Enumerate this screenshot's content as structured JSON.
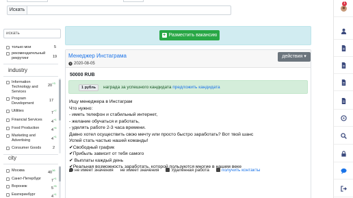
{
  "search": {
    "button_label": "Искать",
    "placeholder": ""
  },
  "sidebar": {
    "filter_placeholder": "искать",
    "top_items": [
      {
        "label": "только мои",
        "count": "5"
      },
      {
        "label": "рекомендательный рекрутинг",
        "count": "19"
      }
    ],
    "industry_title": "industry",
    "industry_items": [
      {
        "label": "Information Technology and Services",
        "count": "20",
        "delta": "+3"
      },
      {
        "label": "Program Development",
        "count": "17",
        "delta": ""
      },
      {
        "label": "Utilities",
        "count": "7",
        "delta": "+7"
      },
      {
        "label": "Financial Services",
        "count": "4",
        "delta": "+1"
      },
      {
        "label": "Food Production",
        "count": "4",
        "delta": "+4"
      },
      {
        "label": "Marketing and Advertising",
        "count": "4",
        "delta": "+1"
      },
      {
        "label": "Consumer Goods",
        "count": "2",
        "delta": ""
      }
    ],
    "city_title": "city",
    "city_items": [
      {
        "label": "Москва",
        "count": "40",
        "delta": "16"
      },
      {
        "label": "Санкт-Петербург",
        "count": "7",
        "delta": "+1"
      },
      {
        "label": "Воронеж",
        "count": "5",
        "delta": "+5"
      },
      {
        "label": "Екатеринбург",
        "count": "4",
        "delta": "+1"
      }
    ]
  },
  "main": {
    "post_button": "Разместить вакансию",
    "card": {
      "title": "Менеджер Инстаграма",
      "date": "2020-08-05",
      "actions_label": "действия",
      "salary": "50000 RUB",
      "reward_badge": "1 рубль",
      "reward_text": "награда за успешного кандидата",
      "reward_link": "предложить кандидата",
      "description": [
        "Ищу менеджера в Инстаграм",
        "Что нужно:",
        "- иметь телефон и стабильный интернет,",
        "- желание обучаться и работать,",
        "- уделять работе 2-3 часа времени.",
        "Давно хотел осуществить свою мечту или просто быстро заработать? Вот твой шанс",
        "Успей стать частью нашей команды!",
        "✔Свободный график",
        "✔Прибыль зависит от тебя самого",
        "✔ Выплаты каждый день",
        "✔Реальная возможность заработать, которой пользуются многие в нашем веке"
      ],
      "footer": {
        "location": "не имеет значения",
        "experience": "не имеет значения",
        "remote": "Удаленная работа",
        "contacts_link": "получить контакты"
      }
    }
  },
  "rail": {
    "notification_count": "1",
    "icons": [
      "avatar-icon",
      "user-icon",
      "document-icon",
      "document-icon",
      "document-icon",
      "document-icon",
      "compass-icon",
      "search-icon",
      "lock-icon",
      "chat-icon",
      "logout-icon"
    ]
  }
}
